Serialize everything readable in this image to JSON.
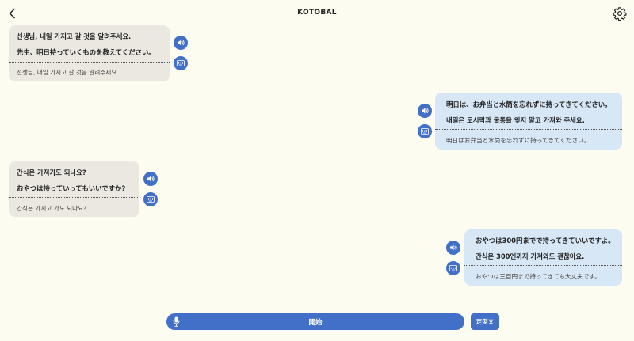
{
  "header": {
    "title": "KOTOBAL"
  },
  "messages": [
    {
      "side": "left",
      "line1": "선생님, 내일 가지고 갈 것을 알려주세요.",
      "line2": "先生、明日持っていくものを教えてください。",
      "line3": "선생님, 내일 가지고 갈 것을 알려주세요."
    },
    {
      "side": "right",
      "line1": "明日は、お弁当と水筒を忘れずに持ってきてください。",
      "line2": "내일은 도시락과 물통을 잊지 말고 가져와 주세요.",
      "line3": "明日はお弁当と水筒を忘れずに持ってきてください。"
    },
    {
      "side": "left",
      "line1": "간식은 가져가도 되나요?",
      "line2": "おやつは持っていってもいいですか?",
      "line3": "간식은 가지고 가도 되나요?"
    },
    {
      "side": "right",
      "line1": "おやつは300円までで持ってきていいですよ。",
      "line2": "간식은 300엔까지 가져와도 괜찮아요.",
      "line3": "おやつは三百円まで持ってきても大丈夫です。"
    }
  ],
  "footer": {
    "start_label": "開始",
    "phrase_label": "定型文"
  },
  "colors": {
    "accent": "#4270c8",
    "background": "#fdfcf1",
    "bubble_left": "#ebe8e2",
    "bubble_right": "#d7e7f6"
  },
  "icons": {
    "back": "chevron-left-icon",
    "settings": "gear-icon",
    "speaker": "speaker-icon",
    "keyboard": "keyboard-icon",
    "mic": "mic-icon"
  }
}
